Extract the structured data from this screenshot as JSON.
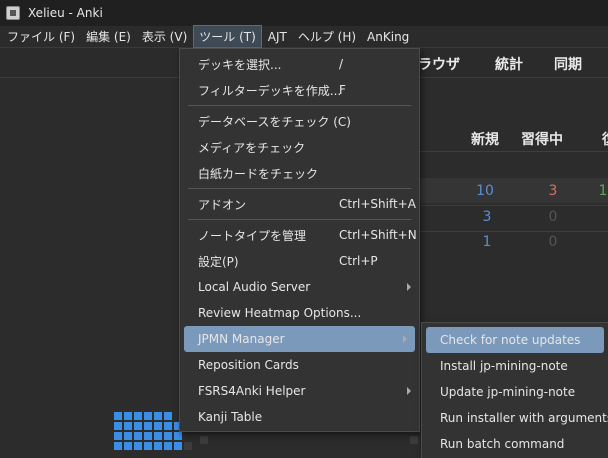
{
  "window": {
    "title": "Xelieu - Anki",
    "icon": "anki-app-icon"
  },
  "menubar": {
    "items": [
      {
        "label": "ファイル (F)"
      },
      {
        "label": "編集 (E)"
      },
      {
        "label": "表示 (V)"
      },
      {
        "label": "ツール (T)"
      },
      {
        "label": "AJT"
      },
      {
        "label": "ヘルプ (H)"
      },
      {
        "label": "AnKing"
      }
    ]
  },
  "toolbar": {
    "browse": "ラウザ",
    "stats": "統計",
    "sync": "同期"
  },
  "deck_table": {
    "headers": {
      "new": "新規",
      "learning": "習得中"
    },
    "rows": [
      {
        "new": "10",
        "learning": "3",
        "review": "1"
      },
      {
        "new": "3",
        "learning": "0"
      },
      {
        "new": "1",
        "learning": "0"
      }
    ]
  },
  "tools_menu": {
    "items": [
      {
        "label": "デッキを選択...",
        "shortcut": "/"
      },
      {
        "label": "フィルターデッキを作成...",
        "shortcut": "F"
      },
      {
        "label": "データベースをチェック (C)",
        "shortcut": ""
      },
      {
        "label": "メディアをチェック",
        "shortcut": ""
      },
      {
        "label": "白紙カードをチェック",
        "shortcut": ""
      },
      {
        "label": "アドオン",
        "shortcut": "Ctrl+Shift+A"
      },
      {
        "label": "ノートタイプを管理",
        "shortcut": "Ctrl+Shift+N"
      },
      {
        "label": "設定(P)",
        "shortcut": "Ctrl+P"
      },
      {
        "label": "Local Audio Server",
        "shortcut": ""
      },
      {
        "label": "Review Heatmap Options...",
        "shortcut": ""
      },
      {
        "label": "JPMN Manager",
        "shortcut": ""
      },
      {
        "label": "Reposition Cards",
        "shortcut": ""
      },
      {
        "label": "FSRS4Anki Helper",
        "shortcut": ""
      },
      {
        "label": "Kanji Table",
        "shortcut": ""
      }
    ]
  },
  "jpmn_submenu": {
    "items": [
      {
        "label": "Check for note updates"
      },
      {
        "label": "Install jp-mining-note"
      },
      {
        "label": "Update jp-mining-note"
      },
      {
        "label": "Run installer with arguments"
      },
      {
        "label": "Run batch command"
      }
    ]
  },
  "colors": {
    "menu_highlight": "#7b99bb",
    "submenu_highlight": "#7b99bb",
    "new_count": "#5a8fd4",
    "learning_count": "#d9715f",
    "review_count": "#5aa55a",
    "heatmap": "#3a8ee6"
  }
}
